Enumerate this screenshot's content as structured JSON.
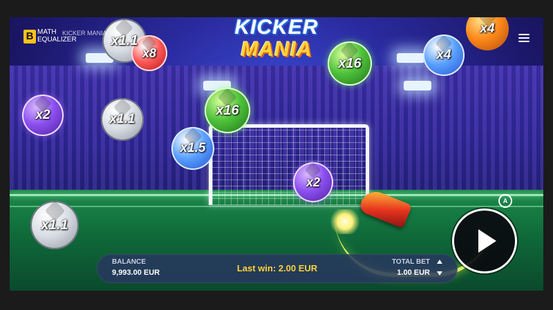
{
  "brand": {
    "badge": "B",
    "name_line1": "MATH",
    "name_line2": "EQUALIZER",
    "game_caption": "KICKER MANIA"
  },
  "logo": {
    "line1": "KICKER",
    "line2": "MANIA"
  },
  "banner_text": "KICKER MANIA",
  "balls": [
    {
      "label": "x1.1",
      "color": "white"
    },
    {
      "label": "x8",
      "color": "red"
    },
    {
      "label": "x2",
      "color": "purple"
    },
    {
      "label": "x1.1",
      "color": "white"
    },
    {
      "label": "x16",
      "color": "green"
    },
    {
      "label": "x1.5",
      "color": "blue"
    },
    {
      "label": "x16",
      "color": "green"
    },
    {
      "label": "x4",
      "color": "blue"
    },
    {
      "label": "x4",
      "color": "orange"
    },
    {
      "label": "x2",
      "color": "purple"
    },
    {
      "label": "x1.1",
      "color": "white"
    }
  ],
  "hud": {
    "balance_label": "BALANCE",
    "balance_value": "9,993.00 EUR",
    "last_win": "Last win: 2.00 EUR",
    "total_bet_label": "TOTAL BET",
    "total_bet_value": "1.00 EUR"
  },
  "icons": {
    "menu": "hamburger-menu-icon",
    "autoplay": "autoplay-icon",
    "play": "play-icon",
    "bet_up": "arrow-up-icon",
    "bet_down": "arrow-down-icon"
  },
  "autoplay_glyph": "A",
  "colors": {
    "accent_yellow": "#ffd23a",
    "hud_bg": "#28375f",
    "field_green": "#0f6a3a"
  }
}
